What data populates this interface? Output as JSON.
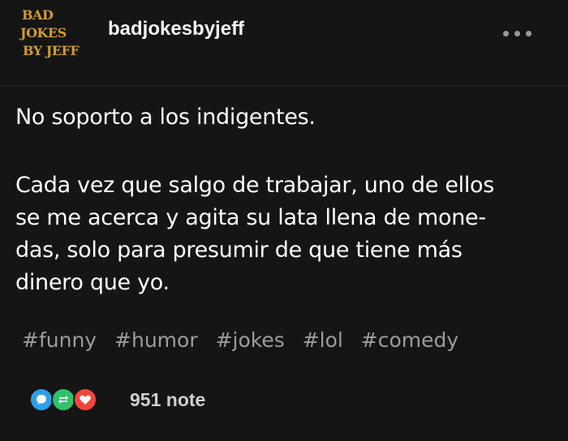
{
  "post": {
    "logo": {
      "line1": "BAD",
      "line2": "JOKES",
      "line3": "BY JEFF"
    },
    "blog_name": "badjokesbyjeff",
    "body_lines": [
      "No soporto a los indigentes.",
      "Cada vez que salgo de trabajar, uno de ellos",
      "se me acerca y agita su lata llena de mone-",
      "das, solo para presumir de que tiene más",
      "dinero que yo."
    ],
    "tags": [
      "#funny",
      "#humor",
      "#jokes",
      "#lol",
      "#comedy"
    ],
    "notes": "951 note"
  },
  "colors": {
    "background": "#151515",
    "logo": "#d39a2e",
    "reply": "#2aa0e8",
    "reblog": "#2fc26a",
    "like": "#f0473b",
    "tag_text": "#9c9c9c"
  },
  "icons": {
    "more": "more-icon",
    "reply": "reply-icon",
    "reblog": "reblog-icon",
    "like": "like-icon"
  }
}
